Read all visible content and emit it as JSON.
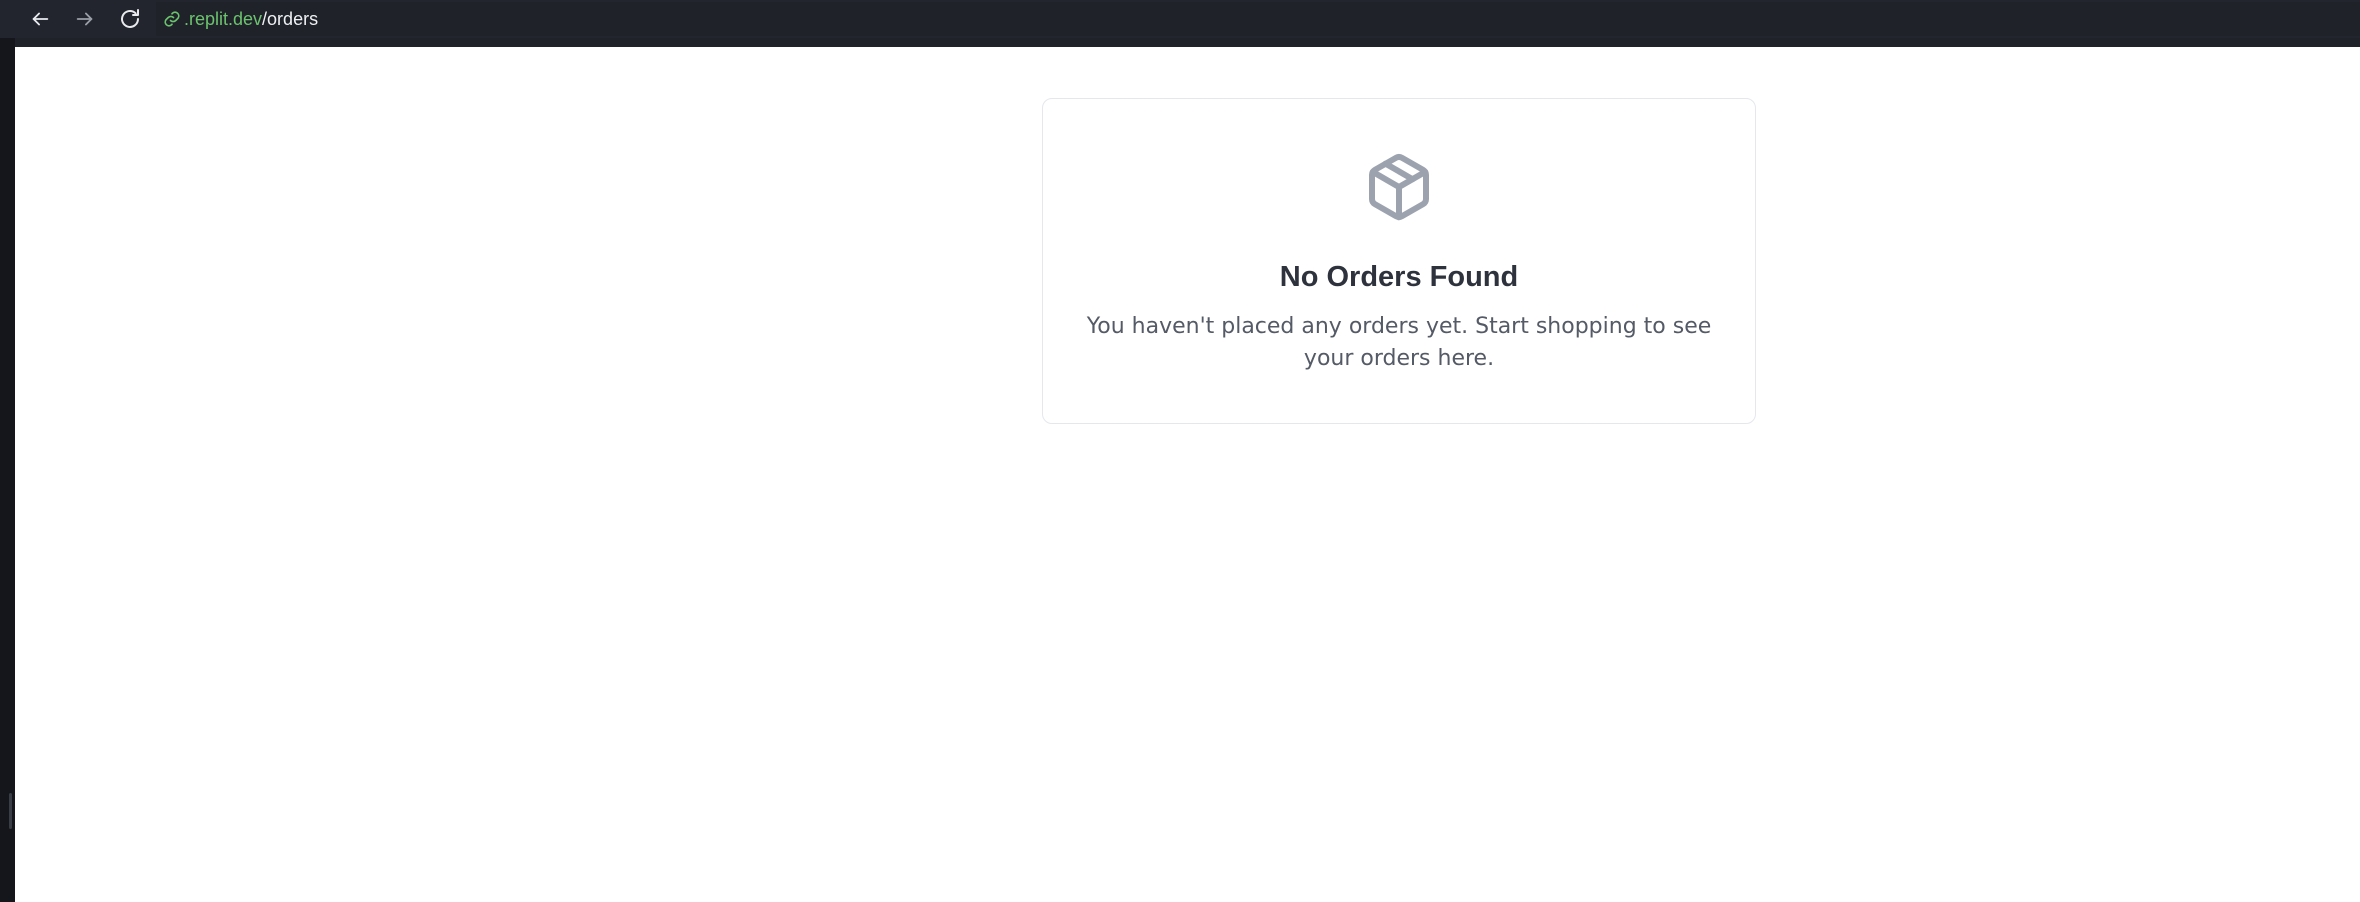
{
  "browser": {
    "url_domain": ".replit.dev",
    "url_path": "/orders",
    "icons": {
      "back": "arrow-left-icon",
      "forward": "arrow-right-icon",
      "reload": "reload-icon",
      "link": "link-icon"
    }
  },
  "empty_state": {
    "icon": "package-box-icon",
    "title": "No Orders Found",
    "message": "You haven't placed any orders yet. Start shopping to see your orders here."
  },
  "colors": {
    "url_domain": "#6cc36e",
    "icon_gray": "#9ca3af",
    "title": "#2d323c",
    "message": "#545a66"
  }
}
